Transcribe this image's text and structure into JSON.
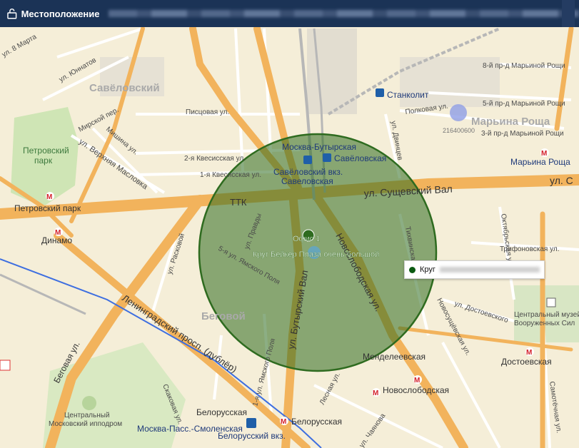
{
  "header": {
    "title": "Местоположение",
    "lock_icon": "lock-icon"
  },
  "zone": {
    "name": "Круг Бейкер Плаза очень большой",
    "office": "Офис 1",
    "callout_label": "Круг",
    "color": "#2e6b1f"
  },
  "labels": {
    "saveloskiy": "Савёловский",
    "begovoy": "Беговой",
    "maryina_roshcha_area": "Марьина Роща",
    "petrovsky_park": "Петровский\nпарк",
    "ttk": "ТТК",
    "suschevsky_val": "ул. Сущевский Вал",
    "leningradsky": "Ленинградский просп. (дублёр)",
    "novoslobodskaya_ul": "Новослободская ул.",
    "butyrsky_val": "ул. Бутырский Вал",
    "begovaya_ul": "Беговая ул.",
    "st_1_marta": "ул. 8 Марта",
    "st_yunnatov": "ул. Юннатов",
    "mirsky": "Мирской пер.",
    "mishina": "Мишина ул.",
    "verkh_maslovka": "ул. Верхняя Масловка",
    "pistsovaya": "Писцовая ул.",
    "kvesisskaya2": "2-я Квесисская ул.",
    "kvesisskaya1": "1-я Квесисская ул.",
    "yamskogo5": "5-я ул. Ямского Поля",
    "yamskogo1": "1-я ул. Ямского Поля",
    "pravdy": "ул. Правды",
    "raskovoy": "ул. Расковой",
    "polkovaya": "Полковая ул.",
    "danchenko": "ул. Двинцев",
    "tikhvinskaya": "Тихвинская ул.",
    "oktyabrskaya": "Октябрьская ул.",
    "trifonovskaya": "Трифоновская ул.",
    "dostoevskogo": "ул. Достоевского",
    "novosuschevskaya": "Новосущёвская ул.",
    "samotechnaya": "Самотёчная ул.",
    "skakovaya": "Скаковая ул.",
    "lesnaya": "Лесная ул.",
    "chayanova": "ул. Чаянова",
    "maryina_5": "5-й пр-д Марьиной Рощи",
    "maryina_3": "3-й пр-д Марьиной Рощи",
    "maryina_4": "4-й пр-д Марьиной Рощи",
    "maryina_8": "8-й пр-д Марьиной Рощи",
    "museum": "Центральный музей\nВооруженных Сил",
    "hippodrome": "Центральный\nМосковский ипподром",
    "code": "216400600"
  },
  "stations": [
    {
      "name": "Москва-Бутырская",
      "kind": "rail"
    },
    {
      "name": "Савёловская",
      "kind": "metro"
    },
    {
      "name": "Савёловский вкз.",
      "kind": "rail"
    },
    {
      "name": "Савеловская",
      "kind": "metro"
    },
    {
      "name": "Станколит",
      "kind": "rail"
    },
    {
      "name": "Марьина Роща",
      "kind": "metro"
    },
    {
      "name": "Петровский парк",
      "kind": "metro"
    },
    {
      "name": "Динамо",
      "kind": "metro"
    },
    {
      "name": "Менделеевская",
      "kind": "metro"
    },
    {
      "name": "Достоевская",
      "kind": "metro"
    },
    {
      "name": "Новослободская",
      "kind": "metro"
    },
    {
      "name": "Белорусская",
      "kind": "metro"
    },
    {
      "name": "Белорусская",
      "kind": "metro"
    },
    {
      "name": "Москва-Пасс.-Смоленская",
      "kind": "rail"
    },
    {
      "name": "Белорусский вкз.",
      "kind": "rail"
    }
  ]
}
